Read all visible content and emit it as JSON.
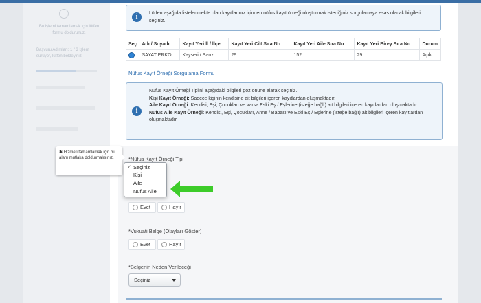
{
  "sidebar": {
    "help_text": "Bu işlemi tamamlamak için lütfen formu doldurunuz.",
    "progress_text": "Başvuru Adımları: 1 / 3 İşlem sürüyor, lütfen bekleyiniz.",
    "progress": 0.65
  },
  "notice": {
    "text": "Lütfen aşağıda listelenmekte olan kayıtlarınız içinden nüfus kayıt örneği oluşturmak istediğiniz sorgulamaya esas olacak bilgileri seçiniz."
  },
  "table": {
    "headers": [
      "Seç",
      "Adı / Soyadı",
      "Kayıt Yeri İl / İlçe",
      "Kayıt Yeri Cilt Sıra No",
      "Kayıt Yeri Aile Sıra No",
      "Kayıt Yeri Birey Sıra No",
      "Durum"
    ],
    "rows": [
      {
        "name": "SAYAT ERKOL",
        "place": "Kayseri / Sarız",
        "cilt": "29",
        "aile": "152",
        "birey": "29",
        "durum": "Açık"
      }
    ]
  },
  "form": {
    "title": "Nüfus Kayıt Örneği Sorgulama Formu",
    "info_intro": "Nüfus Kayıt Örneği Tipi'ni aşağıdaki bilgileri göz önüne alarak seçiniz.",
    "info_kisi_label": "Kişi Kayıt Örneği:",
    "info_kisi_text": " Sadece kişinin kendisine ait bilgileri içeren kayıtlardan oluşmaktadır.",
    "info_aile_label": "Aile Kayıt Örneği:",
    "info_aile_text": " Kendisi, Eşi, Çocukları ve varsa Eski Eş / Eşlerine (isteğe bağlı) ait bilgileri içeren kayıtlardan oluşmaktadır.",
    "info_nufus_label": "Nüfus Aile Kayıt Örneği:",
    "info_nufus_text": " Kendisi, Eşi, Çocukları, Anne / Babası ve Eski Eş / Eşlerine (isteğe bağlı) ait bilgileri içeren kayıtlardan oluşmaktadır.",
    "q1_label": "*Nüfus Kayıt Örneği Tipi",
    "q1_options": [
      "Seçiniz",
      "Kişi",
      "Aile",
      "Nüfus Aile"
    ],
    "q1_checked": "✓",
    "q2_yes": "Evet",
    "q2_no": "Hayır",
    "q3_label": "*Vukuati Belge (Olayları Göster)",
    "q3_yes": "Evet",
    "q3_no": "Hayır",
    "q4_label": "*Belgenin Neden Verileceği",
    "q4_value": "Seçiniz"
  },
  "tooltip": {
    "text": "✱ Hizmeti tamamlamak için bu alanı mutlaka doldurmalısınız."
  },
  "colors": {
    "accent": "#2f6fb0",
    "arrow": "#3dcc2a",
    "info_bg": "#eef4fa"
  }
}
